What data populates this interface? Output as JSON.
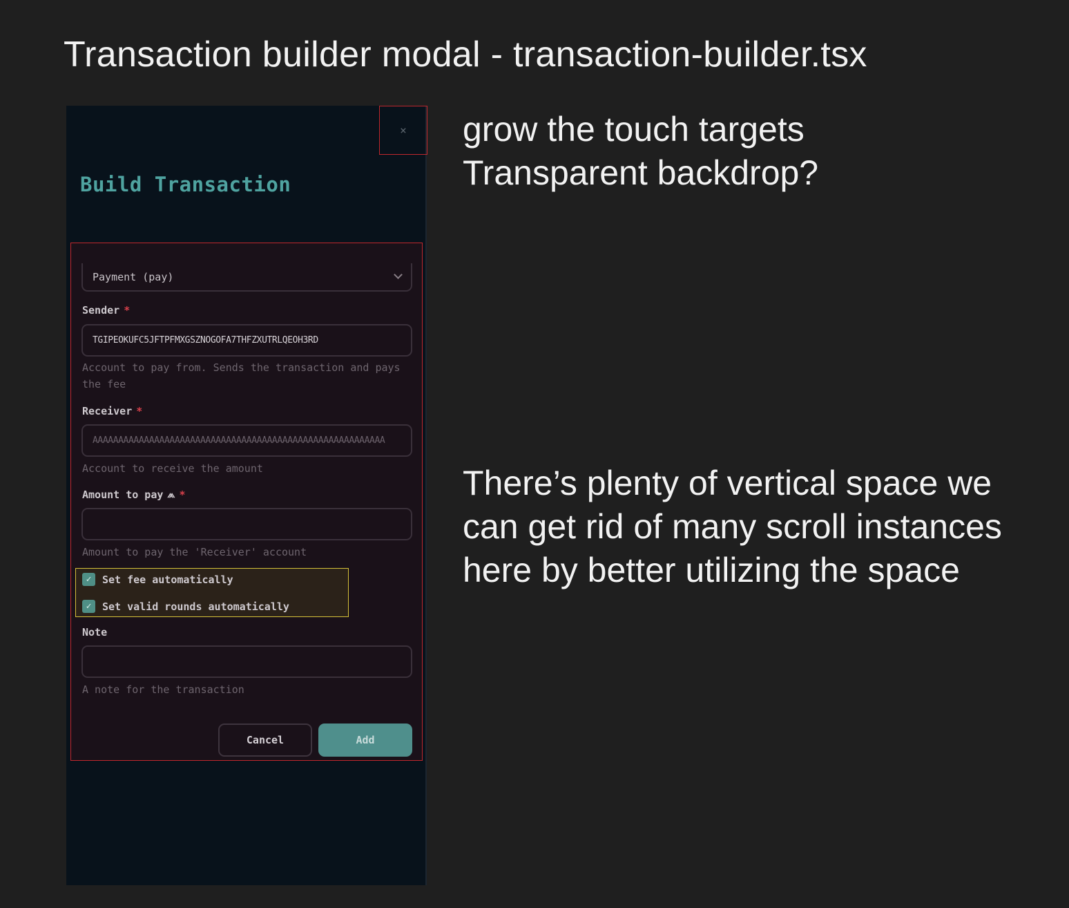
{
  "page": {
    "title": "Transaction builder modal - transaction-builder.tsx"
  },
  "annotations": {
    "note1_line1": "grow the touch targets",
    "note1_line2": "Transparent backdrop?",
    "note2": "There’s plenty of vertical space we can get rid of many scroll instances here by better utilizing the space"
  },
  "modal": {
    "close_icon": "×",
    "title": "Build Transaction",
    "type_select": {
      "value": "Payment (pay)",
      "icon": "chevron-down-icon"
    },
    "sender": {
      "label": "Sender",
      "required_mark": "*",
      "value": "TGIPEOKUFC5JFTPFMXGSZNOGOFA7THFZXUTRLQEOH3RD",
      "help": "Account to pay from. Sends the transaction and pays the fee"
    },
    "receiver": {
      "label": "Receiver",
      "required_mark": "*",
      "placeholder": "AAAAAAAAAAAAAAAAAAAAAAAAAAAAAAAAAAAAAAAAAAAAAAAAAAAAAAAAA",
      "help": "Account to receive the amount"
    },
    "amount": {
      "label": "Amount to pay",
      "icon": "⩕",
      "required_mark": "*",
      "value": "",
      "help": "Amount to pay the 'Receiver' account"
    },
    "checkboxes": [
      {
        "label": "Set fee automatically",
        "checked": true
      },
      {
        "label": "Set valid rounds automatically",
        "checked": true
      }
    ],
    "note": {
      "label": "Note",
      "value": "",
      "help": "A note for the transaction"
    },
    "buttons": {
      "cancel": "Cancel",
      "add": "Add"
    }
  },
  "colors": {
    "background": "#1f1f1f",
    "modal_bg": "#08121b",
    "form_bg": "#1a1119",
    "accent": "#4fa3a0",
    "primary_button": "#4f8f8c",
    "annotation_red": "#c0272d",
    "annotation_yellow": "#d6c239",
    "required": "#d9414c"
  }
}
